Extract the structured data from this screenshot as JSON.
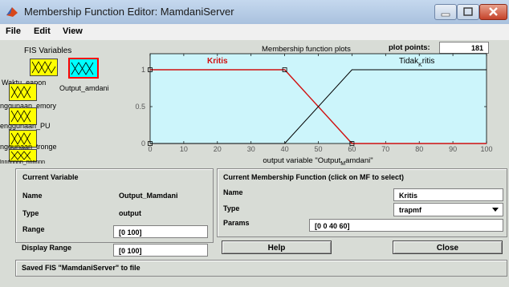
{
  "window": {
    "title": "Membership Function Editor: MamdaniServer"
  },
  "menu": {
    "file": "File",
    "edit": "Edit",
    "view": "View"
  },
  "fis": {
    "title": "FIS Variables",
    "labels": [
      "Waktu_eapon",
      "Output_amdani",
      "nggunaan_emory",
      "enggunaan_PU",
      "nggunaan_tronge",
      "lnnrlnnnn_nnnnnn"
    ]
  },
  "plot": {
    "header": "Membership function plots",
    "points_label": "plot points:",
    "points_value": "181",
    "xlabel": "output variable \"Output",
    "xlabel_sub": "M",
    "xlabel_end": "amdani\""
  },
  "chart_data": {
    "type": "line",
    "xlim": [
      0,
      100
    ],
    "ylim": [
      0,
      1
    ],
    "xticks": [
      "0",
      "10",
      "20",
      "30",
      "40",
      "50",
      "60",
      "70",
      "80",
      "90",
      "100"
    ],
    "yticks": [
      "0",
      "0.5",
      "1"
    ],
    "series": [
      {
        "name": "Kritis",
        "type": "trapmf",
        "params": [
          0,
          0,
          40,
          60
        ],
        "color": "#d01010",
        "selected": true
      },
      {
        "name": "Tidak_ritis",
        "type": "trapmf",
        "params": [
          40,
          60,
          100,
          100
        ],
        "color": "#000000",
        "selected": false
      }
    ],
    "labels": {
      "kritis": "Kritis",
      "tidak_main": "Tidak",
      "tidak_sub": "K",
      "tidak_end": "ritis"
    },
    "background": "#ccf5fb"
  },
  "current_variable": {
    "title": "Current Variable",
    "name_label": "Name",
    "name_value": "Output_Mamdani",
    "type_label": "Type",
    "type_value": "output",
    "range_label": "Range",
    "range_value": "[0 100]",
    "display_range_label": "Display Range",
    "display_range_value": "[0 100]"
  },
  "current_mf": {
    "title": "Current Membership Function (click on MF to select)",
    "name_label": "Name",
    "name_value": "Kritis",
    "type_label": "Type",
    "type_value": "trapmf",
    "params_label": "Params",
    "params_value": "[0 0 40 60]"
  },
  "buttons": {
    "help": "Help",
    "close": "Close"
  },
  "status": {
    "text": "Saved FIS \"MamdaniServer\" to file"
  }
}
